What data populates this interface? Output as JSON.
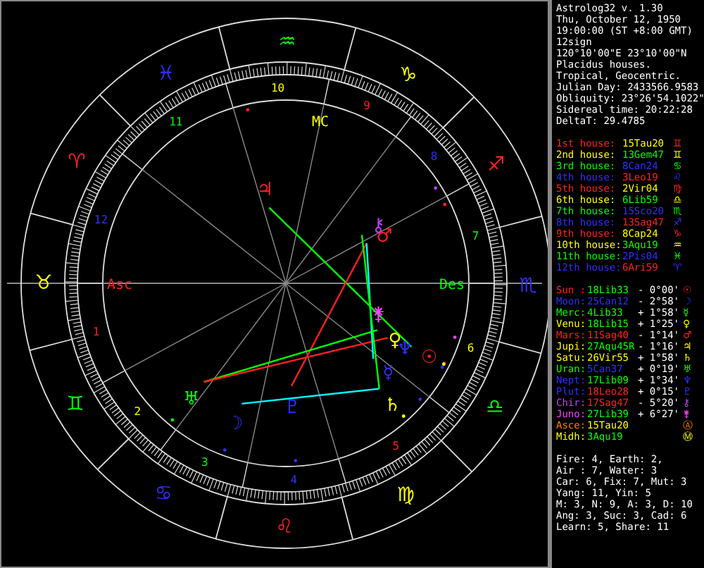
{
  "header": [
    "Astrolog32 v. 1.30",
    "Thu, October 12, 1950",
    "19:00:00 (ST +8:00 GMT)",
    "12sign",
    "120°10'00\"E 23°10'00\"N",
    "Placidus houses.",
    "Tropical, Geocentric.",
    "Julian Day: 2433566.9583",
    "Obliquity: 23°26'54.1022\"",
    "Sidereal time: 20:22:28",
    "DeltaT: 29.4785"
  ],
  "houses": [
    {
      "label": "1st house:",
      "color": "#ff2020",
      "cusp": {
        "text": "15Tau20",
        "color": "#ffff00"
      },
      "glyph": "♊"
    },
    {
      "label": "2nd house:",
      "color": "#ffff00",
      "cusp": {
        "text": "13Gem47",
        "color": "#00ff00"
      },
      "glyph": "♊"
    },
    {
      "label": "3rd house:",
      "color": "#00ff00",
      "cusp": {
        "text": "8Can24",
        "color": "#3030ff"
      },
      "glyph": "♋"
    },
    {
      "label": "4th house:",
      "color": "#3030ff",
      "cusp": {
        "text": "3Leo19",
        "color": "#ff2020"
      },
      "glyph": "♌"
    },
    {
      "label": "5th house:",
      "color": "#ff2020",
      "cusp": {
        "text": "2Vir04",
        "color": "#ffff00"
      },
      "glyph": "♍"
    },
    {
      "label": "6th house:",
      "color": "#ffff00",
      "cusp": {
        "text": "6Lib59",
        "color": "#00ff00"
      },
      "glyph": "♎"
    },
    {
      "label": "7th house:",
      "color": "#00ff00",
      "cusp": {
        "text": "15Sco20",
        "color": "#3030ff"
      },
      "glyph": "♏"
    },
    {
      "label": "8th house:",
      "color": "#3030ff",
      "cusp": {
        "text": "13Sag47",
        "color": "#ff2020"
      },
      "glyph": "♐"
    },
    {
      "label": "9th house:",
      "color": "#ff2020",
      "cusp": {
        "text": "8Cap24",
        "color": "#ffff00"
      },
      "glyph": "♑"
    },
    {
      "label": "10th house:",
      "color": "#ffff00",
      "cusp": {
        "text": "3Aqu19",
        "color": "#00ff00"
      },
      "glyph": "♒"
    },
    {
      "label": "11th house:",
      "color": "#00ff00",
      "cusp": {
        "text": "2Pis04",
        "color": "#3030ff"
      },
      "glyph": "♓"
    },
    {
      "label": "12th house:",
      "color": "#3030ff",
      "cusp": {
        "text": "6Ari59",
        "color": "#ff2020"
      },
      "glyph": "♈"
    }
  ],
  "planets": [
    {
      "name": "Sun :",
      "color": "#ff2020",
      "position": {
        "text": "18Lib33",
        "color": "#00ff00"
      },
      "aspect": "- 0°00'",
      "glyph": "☉"
    },
    {
      "name": "Moon:",
      "color": "#3030ff",
      "position": {
        "text": "25Can12",
        "color": "#3030ff"
      },
      "aspect": "- 2°58'",
      "glyph": "☽"
    },
    {
      "name": "Merc:",
      "color": "#00ff00",
      "position": {
        "text": "4Lib33",
        "color": "#00ff00"
      },
      "aspect": "+ 1°58'",
      "glyph": "☿"
    },
    {
      "name": "Venu:",
      "color": "#ffff00",
      "position": {
        "text": "18Lib15",
        "color": "#00ff00"
      },
      "aspect": "+ 1°25'",
      "glyph": "♀"
    },
    {
      "name": "Mars:",
      "color": "#ff2020",
      "position": {
        "text": "11Sag40",
        "color": "#ff2020"
      },
      "aspect": "- 1°14'",
      "glyph": "♂"
    },
    {
      "name": "Jupi:",
      "color": "#ffff00",
      "position": {
        "text": "27Aqu45R",
        "color": "#00ff00"
      },
      "aspect": "- 1°16'",
      "glyph": "♃"
    },
    {
      "name": "Satu:",
      "color": "#ffff00",
      "position": {
        "text": "26Vir55",
        "color": "#ffff00"
      },
      "aspect": "+ 1°58'",
      "glyph": "♄"
    },
    {
      "name": "Uran:",
      "color": "#00ff00",
      "position": {
        "text": "5Can37",
        "color": "#3030ff"
      },
      "aspect": "+ 0°19'",
      "glyph": "♅"
    },
    {
      "name": "Nept:",
      "color": "#3030ff",
      "position": {
        "text": "17Lib09",
        "color": "#00ff00"
      },
      "aspect": "+ 1°34'",
      "glyph": "♆"
    },
    {
      "name": "Plut:",
      "color": "#3030ff",
      "position": {
        "text": "18Leo28",
        "color": "#ff2020"
      },
      "aspect": "+ 0°15'",
      "glyph": "♇"
    },
    {
      "name": "Chir:",
      "color": "#c040ff",
      "position": {
        "text": "17Sag47",
        "color": "#ff2020"
      },
      "aspect": "- 5°20'",
      "glyph": "⚷"
    },
    {
      "name": "Juno:",
      "color": "#ff40ff",
      "position": {
        "text": "27Lib39",
        "color": "#00ff00"
      },
      "aspect": "+ 6°27'",
      "glyph": "⚵"
    },
    {
      "name": "Asce:",
      "color": "#ff8000",
      "position": {
        "text": "15Tau20",
        "color": "#ffff00"
      },
      "glyph": "Ⓐ"
    },
    {
      "name": "Midh:",
      "color": "#ffff00",
      "position": {
        "text": "3Aqu19",
        "color": "#00ff00"
      },
      "glyph": "Ⓜ"
    }
  ],
  "summary": [
    "Fire: 4, Earth: 2,",
    "Air : 7, Water: 3",
    "Car: 6, Fix: 7, Mut: 3",
    "Yang: 11, Yin: 5",
    "M: 3, N: 9, A: 3, D: 10",
    "Ang: 3, Suc: 3, Cad: 6",
    "Learn: 5, Share: 11"
  ],
  "wheel": {
    "signs": [
      {
        "glyph": "♈",
        "color": "#ff2020"
      },
      {
        "glyph": "♉",
        "color": "#ffff00"
      },
      {
        "glyph": "♊",
        "color": "#00ff00"
      },
      {
        "glyph": "♋",
        "color": "#3030ff"
      },
      {
        "glyph": "♌",
        "color": "#ff2020"
      },
      {
        "glyph": "♍",
        "color": "#ffff00"
      },
      {
        "glyph": "♎",
        "color": "#00ff00"
      },
      {
        "glyph": "♏",
        "color": "#3030ff"
      },
      {
        "glyph": "♐",
        "color": "#ff2020"
      },
      {
        "glyph": "♑",
        "color": "#ffff00"
      },
      {
        "glyph": "♒",
        "color": "#00ff00"
      },
      {
        "glyph": "♓",
        "color": "#3030ff"
      }
    ],
    "house_numbers": [
      "1",
      "2",
      "3",
      "4",
      "5",
      "6",
      "7",
      "8",
      "9",
      "10",
      "11",
      "12"
    ],
    "angles": [
      {
        "label": "Asc",
        "color": "#ff2020"
      },
      {
        "label": "MC",
        "color": "#ffff00"
      },
      {
        "label": "Des",
        "color": "#00ff00"
      }
    ],
    "planets": [
      {
        "glyph": "☉",
        "color": "#ff2020"
      },
      {
        "glyph": "☽",
        "color": "#3030ff"
      },
      {
        "glyph": "☿",
        "color": "#3030ff"
      },
      {
        "glyph": "♀",
        "color": "#ffff00"
      },
      {
        "glyph": "♂",
        "color": "#ff2020"
      },
      {
        "glyph": "♃",
        "color": "#ff2020"
      },
      {
        "glyph": "♄",
        "color": "#ffff00"
      },
      {
        "glyph": "♅",
        "color": "#00ff00"
      },
      {
        "glyph": "♆",
        "color": "#3030ff"
      },
      {
        "glyph": "♇",
        "color": "#3030ff"
      },
      {
        "glyph": "⚷",
        "color": "#c040ff"
      },
      {
        "glyph": "⚵",
        "color": "#ff40ff"
      }
    ]
  }
}
